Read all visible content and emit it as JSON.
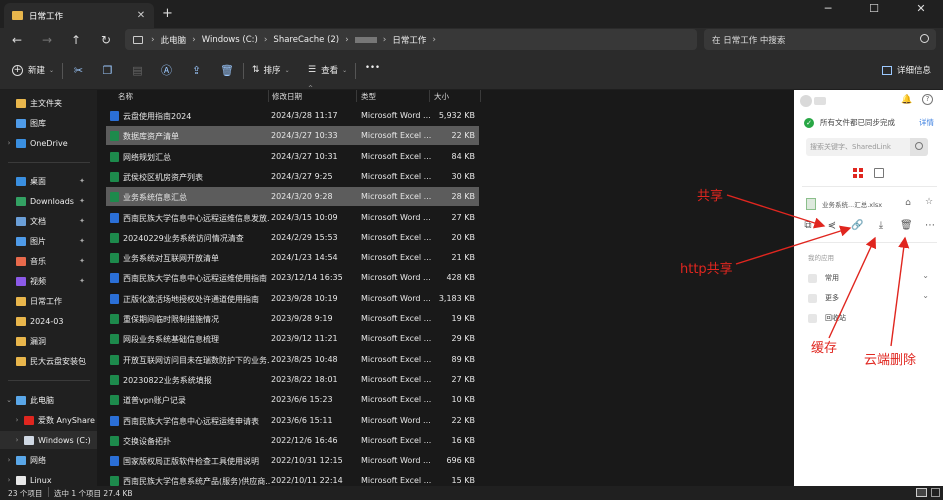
{
  "titlebar": {
    "tab_title": "日常工作",
    "close_glyph": "✕",
    "new_tab_glyph": "+",
    "minimize_glyph": "─",
    "maximize_glyph": "☐",
    "close_window_glyph": "✕"
  },
  "address": {
    "nav_back": "←",
    "nav_forward": "→",
    "nav_up": "↑",
    "nav_refresh": "↻",
    "segments": [
      "此电脑",
      "Windows (C:)",
      "ShareCache (2)",
      "",
      "日常工作"
    ],
    "search_placeholder": "在 日常工作 中搜索"
  },
  "toolbar": {
    "new_label": "新建",
    "sort_label": "排序",
    "view_label": "查看",
    "more_label": "•••",
    "details_label": "详细信息"
  },
  "sidebar": {
    "items": [
      {
        "label": "主文件夹",
        "icon": "home-icon",
        "color": "#e8b64c"
      },
      {
        "label": "图库",
        "icon": "gallery-icon",
        "color": "#4f9be8"
      },
      {
        "label": "OneDrive",
        "icon": "cloud-icon",
        "color": "#3a8fe0"
      },
      {
        "label": "桌面",
        "icon": "desktop-icon",
        "color": "#3a8fe0"
      },
      {
        "label": "Downloads",
        "icon": "download-icon",
        "color": "#33a163"
      },
      {
        "label": "文档",
        "icon": "documents-icon",
        "color": "#6b9fd8"
      },
      {
        "label": "图片",
        "icon": "pictures-icon",
        "color": "#4f9be8"
      },
      {
        "label": "音乐",
        "icon": "music-icon",
        "color": "#e86a4c"
      },
      {
        "label": "视频",
        "icon": "videos-icon",
        "color": "#8c5ae8"
      },
      {
        "label": "日常工作",
        "icon": "folder-icon",
        "color": "#e8b64c"
      },
      {
        "label": "2024-03",
        "icon": "folder-icon",
        "color": "#e8b64c"
      },
      {
        "label": "漏洞",
        "icon": "folder-icon",
        "color": "#e8b64c"
      },
      {
        "label": "民大云盘安装包",
        "icon": "folder-icon",
        "color": "#e8b64c"
      },
      {
        "label": "此电脑",
        "icon": "computer-icon",
        "color": "#5aa7e8"
      },
      {
        "label": "爱数 AnyShare",
        "icon": "anyshare-icon",
        "color": "#e0261f"
      },
      {
        "label": "Windows (C:)",
        "icon": "drive-icon",
        "color": "#cfd8e3"
      },
      {
        "label": "网络",
        "icon": "network-icon",
        "color": "#5aa7e8"
      },
      {
        "label": "Linux",
        "icon": "linux-icon",
        "color": "#e8e8e8"
      }
    ]
  },
  "columns": {
    "name": "名称",
    "date": "修改日期",
    "type": "类型",
    "size": "大小"
  },
  "files": [
    {
      "name": "云盘使用指南2024",
      "date": "2024/3/28 11:17",
      "type": "Microsoft Word ...",
      "size": "5,932 KB",
      "kind": "word"
    },
    {
      "name": "数据库资产清单",
      "date": "2024/3/27 10:33",
      "type": "Microsoft Excel ...",
      "size": "22 KB",
      "kind": "excel"
    },
    {
      "name": "网络规划汇总",
      "date": "2024/3/27 10:31",
      "type": "Microsoft Excel ...",
      "size": "84 KB",
      "kind": "excel"
    },
    {
      "name": "武侯校区机房资产列表",
      "date": "2024/3/27 9:25",
      "type": "Microsoft Excel ...",
      "size": "30 KB",
      "kind": "excel"
    },
    {
      "name": "业务系统信息汇总",
      "date": "2024/3/20 9:28",
      "type": "Microsoft Excel ...",
      "size": "28 KB",
      "kind": "excel"
    },
    {
      "name": "西南民族大学信息中心远程运维信息发放...",
      "date": "2024/3/15 10:09",
      "type": "Microsoft Word ...",
      "size": "27 KB",
      "kind": "word"
    },
    {
      "name": "20240229业务系统访问情况清查",
      "date": "2024/2/29 15:53",
      "type": "Microsoft Excel ...",
      "size": "20 KB",
      "kind": "excel"
    },
    {
      "name": "业务系统对互联网开放清单",
      "date": "2024/1/23 14:54",
      "type": "Microsoft Excel ...",
      "size": "21 KB",
      "kind": "excel"
    },
    {
      "name": "西南民族大学信息中心远程运维使用指南",
      "date": "2023/12/14 16:35",
      "type": "Microsoft Word ...",
      "size": "428 KB",
      "kind": "word"
    },
    {
      "name": "正版化激活场地授权处许通道使用指南",
      "date": "2023/9/28 10:19",
      "type": "Microsoft Word ...",
      "size": "3,183 KB",
      "kind": "word"
    },
    {
      "name": "重保期间临时限制措施情况",
      "date": "2023/9/28 9:19",
      "type": "Microsoft Excel ...",
      "size": "19 KB",
      "kind": "excel"
    },
    {
      "name": "网段业务系统基础信息梳理",
      "date": "2023/9/12 11:21",
      "type": "Microsoft Excel ...",
      "size": "29 KB",
      "kind": "excel"
    },
    {
      "name": "开放互联网访问目未在瑞数防护下的业务...",
      "date": "2023/8/25 10:48",
      "type": "Microsoft Excel ...",
      "size": "89 KB",
      "kind": "excel"
    },
    {
      "name": "20230822业务系统填报",
      "date": "2023/8/22 18:01",
      "type": "Microsoft Excel ...",
      "size": "27 KB",
      "kind": "excel"
    },
    {
      "name": "道普vpn账户记录",
      "date": "2023/6/6 15:23",
      "type": "Microsoft Excel ...",
      "size": "10 KB",
      "kind": "excel"
    },
    {
      "name": "西南民族大学信息中心远程运维申请表",
      "date": "2023/6/6 15:11",
      "type": "Microsoft Word ...",
      "size": "22 KB",
      "kind": "word"
    },
    {
      "name": "交换设备拓扑",
      "date": "2022/12/6 16:46",
      "type": "Microsoft Excel ...",
      "size": "16 KB",
      "kind": "excel"
    },
    {
      "name": "国家版权局正版软件检查工具使用说明",
      "date": "2022/10/31 12:15",
      "type": "Microsoft Word ...",
      "size": "696 KB",
      "kind": "word"
    },
    {
      "name": "西南民族大学信息系统产品(服务)供应商...",
      "date": "2022/10/11 22:14",
      "type": "Microsoft Excel ...",
      "size": "15 KB",
      "kind": "excel"
    }
  ],
  "status": {
    "count": "23 个项目",
    "selection": "选中 1 个项目  27.4 KB"
  },
  "panel": {
    "sync_status": "所有文件都已同步完成",
    "detail_link": "详情",
    "search_placeholder": "搜索关键字、SharedLink",
    "file_name": "业务系统...汇总.xlsx",
    "apps_label": "我的应用",
    "apps": [
      "常用",
      "更多",
      "回收站"
    ]
  },
  "annotations": {
    "share": "共享",
    "http_share": "http共享",
    "cache": "缓存",
    "cloud_delete": "云端删除",
    "color": "#e0261f"
  },
  "colors": {
    "excel": "#1d8a4c",
    "word": "#2b6fd6",
    "selected_row": "#5c5c5c",
    "accent": "#9cc9ff"
  }
}
